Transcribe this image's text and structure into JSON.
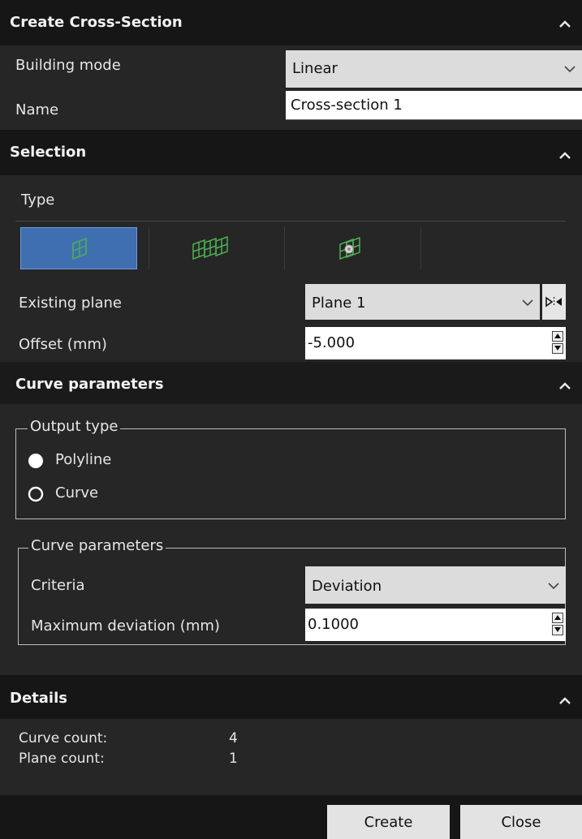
{
  "create_cross_section": {
    "title": "Create Cross-Section",
    "building_mode_label": "Building mode",
    "building_mode_value": "Linear",
    "name_label": "Name",
    "name_value": "Cross-section 1"
  },
  "selection": {
    "title": "Selection",
    "type_label": "Type",
    "type_buttons": [
      "single-plane-icon",
      "multi-plane-icon",
      "radial-plane-icon"
    ],
    "selected_type_index": 0,
    "existing_plane_label": "Existing plane",
    "existing_plane_value": "Plane 1",
    "offset_label": "Offset (mm)",
    "offset_value": "-5.000"
  },
  "curve_parameters": {
    "title": "Curve parameters",
    "output_type_legend": "Output type",
    "options": [
      "Polyline",
      "Curve"
    ],
    "selected_option": "Polyline",
    "group_legend": "Curve parameters",
    "criteria_label": "Criteria",
    "criteria_value": "Deviation",
    "max_dev_label": "Maximum deviation (mm)",
    "max_dev_value": "0.1000"
  },
  "details": {
    "title": "Details",
    "curve_count_label": "Curve count:",
    "curve_count_value": "4",
    "plane_count_label": "Plane count:",
    "plane_count_value": "1"
  },
  "footer": {
    "create_label": "Create",
    "close_label": "Close"
  },
  "colors": {
    "accent": "#3f6fb1",
    "icon_green": "#4caf50",
    "header_bg": "#161616",
    "panel_bg": "#262626"
  }
}
